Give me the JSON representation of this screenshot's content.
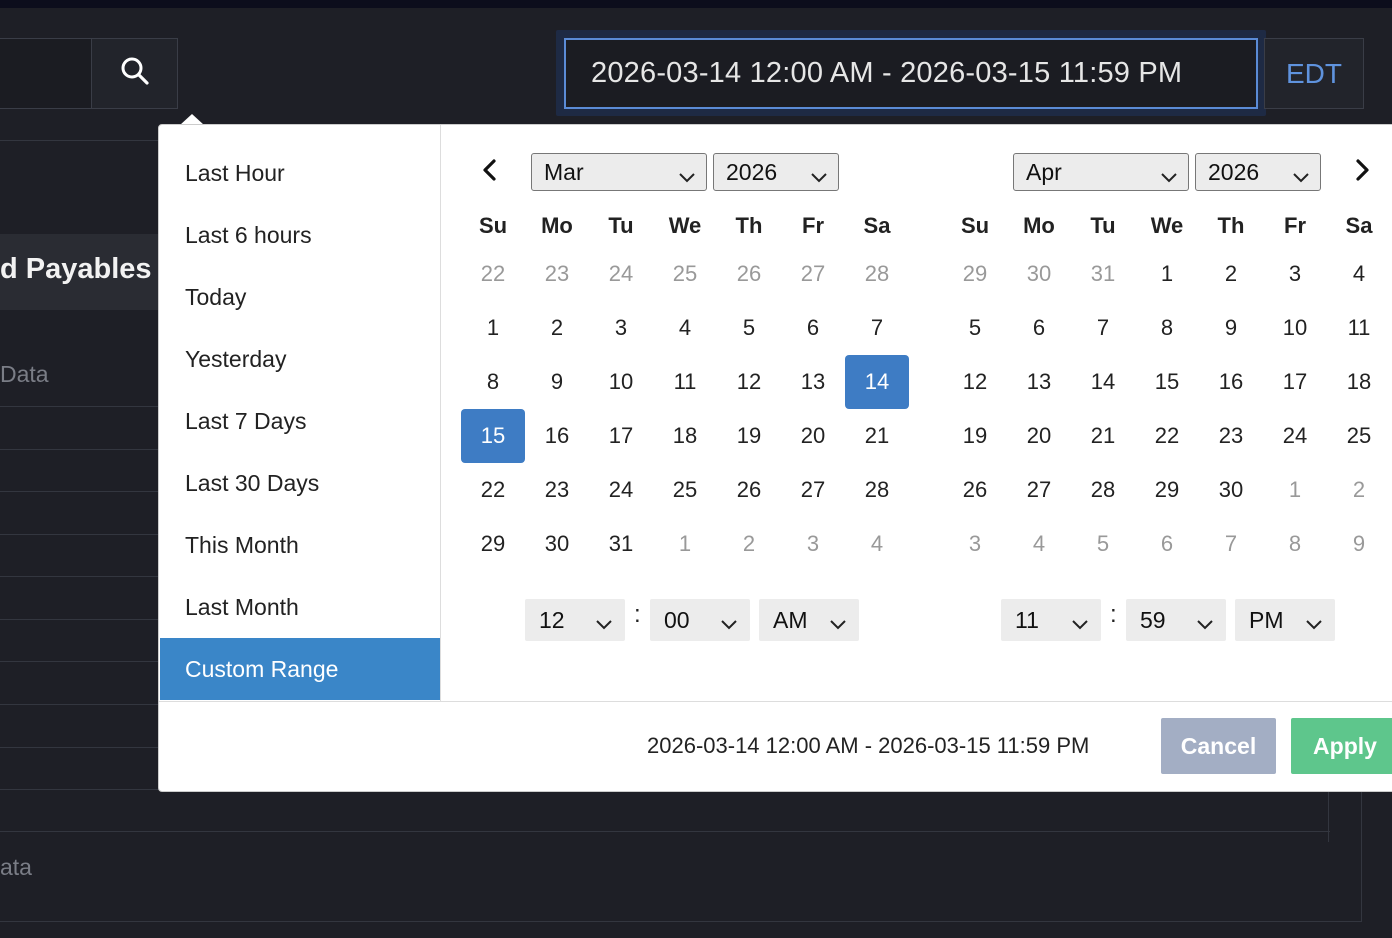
{
  "header": {
    "date_range_value": "2026-03-14 12:00 AM - 2026-03-15 11:59 PM",
    "timezone_label": "EDT",
    "search_icon": "search-icon"
  },
  "background": {
    "section_title": "d Payables",
    "row_label_1": "Data",
    "row_label_2": "ata"
  },
  "ranges": [
    {
      "label": "Last Hour",
      "active": false
    },
    {
      "label": "Last 6 hours",
      "active": false
    },
    {
      "label": "Today",
      "active": false
    },
    {
      "label": "Yesterday",
      "active": false
    },
    {
      "label": "Last 7 Days",
      "active": false
    },
    {
      "label": "Last 30 Days",
      "active": false
    },
    {
      "label": "This Month",
      "active": false
    },
    {
      "label": "Last Month",
      "active": false
    },
    {
      "label": "Custom Range",
      "active": true
    }
  ],
  "weekdays": [
    "Su",
    "Mo",
    "Tu",
    "We",
    "Th",
    "Fr",
    "Sa"
  ],
  "calendars": {
    "left": {
      "month": "Mar",
      "year": "2026",
      "prev_icon": "chevron-left-icon",
      "days": [
        [
          "22",
          "23",
          "24",
          "25",
          "26",
          "27",
          "28"
        ],
        [
          "1",
          "2",
          "3",
          "4",
          "5",
          "6",
          "7"
        ],
        [
          "8",
          "9",
          "10",
          "11",
          "12",
          "13",
          "14"
        ],
        [
          "15",
          "16",
          "17",
          "18",
          "19",
          "20",
          "21"
        ],
        [
          "22",
          "23",
          "24",
          "25",
          "26",
          "27",
          "28"
        ],
        [
          "29",
          "30",
          "31",
          "1",
          "2",
          "3",
          "4"
        ]
      ],
      "selected": [
        "14",
        "15"
      ],
      "time": {
        "hour": "12",
        "minute": "00",
        "ampm": "AM"
      }
    },
    "right": {
      "month": "Apr",
      "year": "2026",
      "next_icon": "chevron-right-icon",
      "days": [
        [
          "29",
          "30",
          "31",
          "1",
          "2",
          "3",
          "4"
        ],
        [
          "5",
          "6",
          "7",
          "8",
          "9",
          "10",
          "11"
        ],
        [
          "12",
          "13",
          "14",
          "15",
          "16",
          "17",
          "18"
        ],
        [
          "19",
          "20",
          "21",
          "22",
          "23",
          "24",
          "25"
        ],
        [
          "26",
          "27",
          "28",
          "29",
          "30",
          "1",
          "2"
        ],
        [
          "3",
          "4",
          "5",
          "6",
          "7",
          "8",
          "9"
        ]
      ],
      "time": {
        "hour": "11",
        "minute": "59",
        "ampm": "PM"
      }
    }
  },
  "footer": {
    "selected_range_text": "2026-03-14 12:00 AM - 2026-03-15 11:59 PM",
    "cancel_label": "Cancel",
    "apply_label": "Apply"
  },
  "colors": {
    "accent": "#3e7cc4",
    "apply": "#5ec68c",
    "cancel": "#a3aec4",
    "active_range": "#3a86c8"
  }
}
